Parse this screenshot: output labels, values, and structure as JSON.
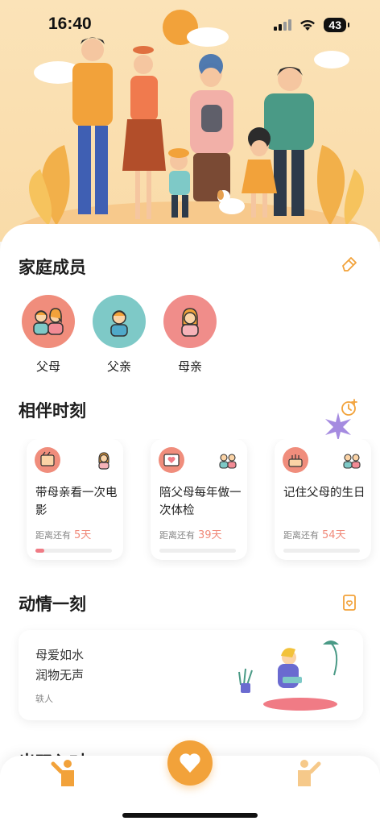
{
  "status": {
    "time": "16:40",
    "battery": "43"
  },
  "sections": {
    "family": {
      "title": "家庭成员"
    },
    "moments": {
      "title": "相伴时刻"
    },
    "touching": {
      "title": "动情一刻"
    },
    "next": {
      "title": "出双入对"
    }
  },
  "members": [
    {
      "name": "父母",
      "bg": "#f08d7c"
    },
    {
      "name": "父亲",
      "bg": "#7ec9c7"
    },
    {
      "name": "母亲",
      "bg": "#f08d8a"
    }
  ],
  "moments": [
    {
      "title": "带母亲看一次电影",
      "prefix": "距离还有",
      "days": "5天",
      "progress": 0.12
    },
    {
      "title": "陪父母每年做一次体检",
      "prefix": "距离还有",
      "days": "39天",
      "progress": 0.0
    },
    {
      "title": "记住父母的生日",
      "prefix": "距离还有",
      "days": "54天",
      "progress": 0.0
    }
  ],
  "quote": {
    "line1": "母爱如水",
    "line2": "润物无声",
    "author": "轶人"
  },
  "tabs": {
    "left": "person-waving-icon",
    "center": "heart-icon",
    "right": "person-waving-icon"
  },
  "colors": {
    "accent": "#f2a23a",
    "coral": "#f08a7a",
    "teal": "#7ec9c7"
  }
}
